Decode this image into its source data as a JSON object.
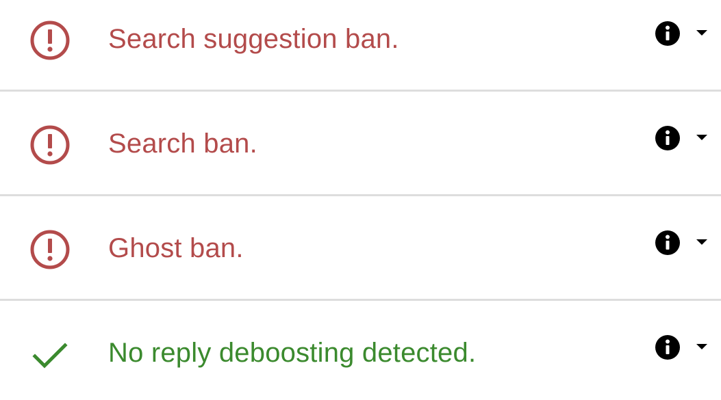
{
  "colors": {
    "fail": "#b34b4b",
    "ok": "#3b8a2e",
    "divider": "#dddddd",
    "icon": "#000000"
  },
  "results": [
    {
      "status": "fail",
      "status_icon": "alert-circle-icon",
      "label": "Search suggestion ban."
    },
    {
      "status": "fail",
      "status_icon": "alert-circle-icon",
      "label": "Search ban."
    },
    {
      "status": "fail",
      "status_icon": "alert-circle-icon",
      "label": "Ghost ban."
    },
    {
      "status": "ok",
      "status_icon": "check-icon",
      "label": "No reply deboosting detected."
    }
  ],
  "row_actions": {
    "info_icon": "info-icon",
    "expand_icon": "chevron-down-icon"
  }
}
